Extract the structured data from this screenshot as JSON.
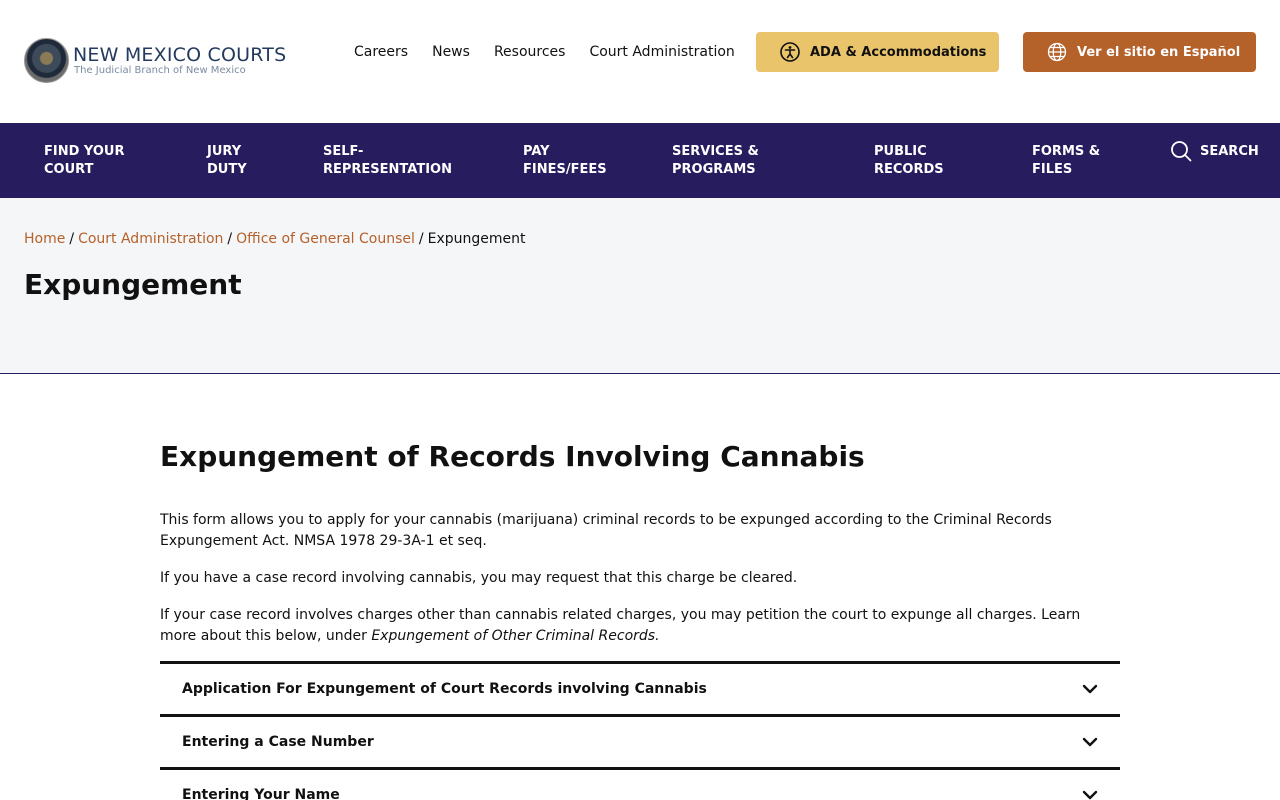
{
  "header": {
    "logo_title": "NEW MEXICO COURTS",
    "logo_subtitle": "The Judicial Branch of New Mexico",
    "util_links": [
      "Careers",
      "News",
      "Resources",
      "Court Administration"
    ],
    "ada_button": "ADA & Accommodations",
    "spanish_button": "Ver el sitio en Español"
  },
  "nav": {
    "items": [
      {
        "line1": "FIND YOUR",
        "line2": "COURT"
      },
      {
        "line1": "JURY",
        "line2": "DUTY"
      },
      {
        "line1": "SELF-",
        "line2": "REPRESENTATION"
      },
      {
        "line1": "PAY",
        "line2": "FINES/FEES"
      },
      {
        "line1": "SERVICES &",
        "line2": "PROGRAMS"
      },
      {
        "line1": "PUBLIC",
        "line2": "RECORDS"
      },
      {
        "line1": "FORMS &",
        "line2": "FILES"
      }
    ],
    "search_label": "SEARCH"
  },
  "breadcrumb": {
    "items": [
      "Home",
      "Court Administration",
      "Office of General Counsel"
    ],
    "current": "Expungement"
  },
  "page_title": "Expungement",
  "content": {
    "section_title": "Expungement of Records Involving Cannabis",
    "p1": "This form allows you to apply for your cannabis (marijuana) criminal records to be expunged according to the Criminal Records Expungement Act. NMSA 1978 29-3A-1 et seq.",
    "p2": "If you have a case record involving cannabis, you may request that this charge be cleared.",
    "p3_text": "If your case record involves charges other than cannabis related charges, you may petition the court to expunge all charges. Learn more about this below, under ",
    "p3_em": "Expungement of Other Criminal Records."
  },
  "accordion": [
    "Application For Expungement of Court Records involving Cannabis",
    "Entering a Case Number",
    "Entering Your Name"
  ],
  "colors": {
    "nav_bg": "#271c5e",
    "ada_bg": "#e9c46a",
    "spanish_bg": "#b5612a",
    "link": "#b5612a",
    "band_bg": "#f5f6f8"
  }
}
